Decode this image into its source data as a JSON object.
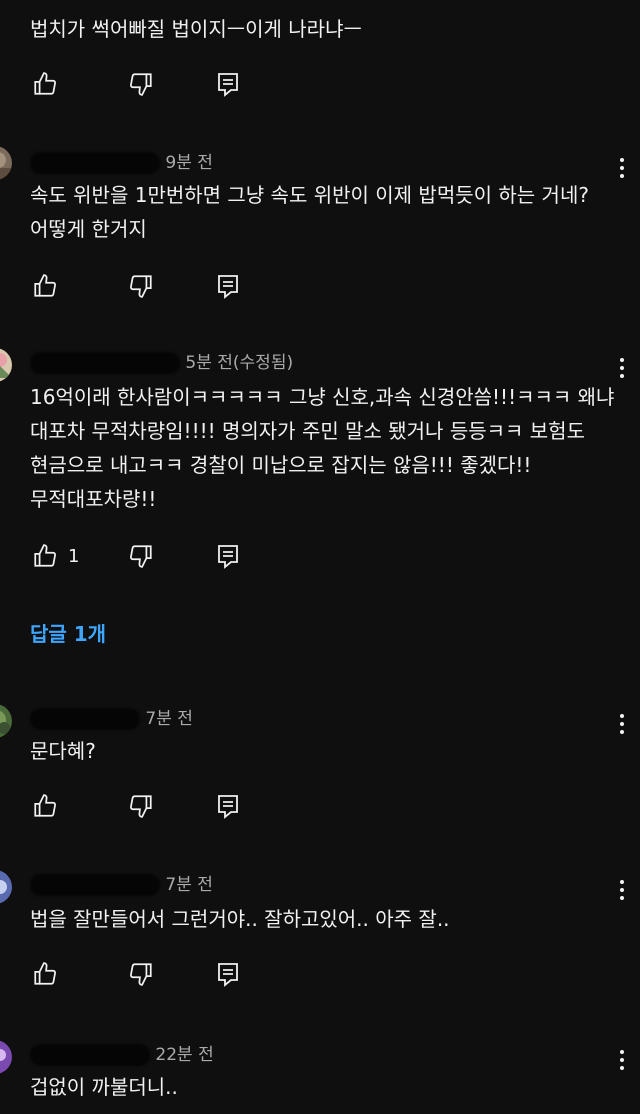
{
  "comments": [
    {
      "author": "@...",
      "time": "",
      "text": "법치가 썩어빠질 법이지ㅡ이게 나라냐ㅡ",
      "likes": "",
      "avatar_color": "#8a8a8a"
    },
    {
      "author": "@...",
      "time": "9분 전",
      "text": "속도 위반을 1만번하면 그냥 속도 위반이 이제 밥먹듯이 하는 거네? 어떻게 한거지",
      "likes": "",
      "avatar_color": "#7a6a5a"
    },
    {
      "author": "@...",
      "time": "5분 전(수정됨)",
      "text": "16억이래 한사람이ㅋㅋㅋㅋㅋ 그냥 신호,과속 신경안씀!!!ㅋㅋㅋ 왜냐 대포차 무적차량임!!!! 명의자가 주민 말소 됐거나 등등ㅋㅋ 보험도 현금으로 내고ㅋㅋ 경찰이 미납으로 잡지는 않음!!! 좋겠다!! 무적대포차량!!",
      "likes": "1",
      "replies_label": "답글 1개",
      "avatar_color": "#c9b79a"
    },
    {
      "author": "@...",
      "time": "7분 전",
      "text": "문다혜?",
      "likes": "",
      "avatar_color": "#6b8a5a"
    },
    {
      "author": "@...",
      "time": "7분 전",
      "text": "법을 잘만들어서 그런거야.. 잘하고있어.. 아주 잘..",
      "likes": "",
      "avatar_color": "#5a6ab0"
    },
    {
      "author": "@...",
      "time": "22분 전",
      "text": "겁없이 까불더니..",
      "likes": "",
      "avatar_color": "#7a4ab0"
    }
  ],
  "colors": {
    "background": "#0f0f0f",
    "text": "#f1f1f1",
    "meta": "#aaaaaa",
    "link": "#3ea6ff"
  },
  "icons": [
    "thumb-up-icon",
    "thumb-down-icon",
    "reply-icon",
    "more-vert-icon"
  ]
}
